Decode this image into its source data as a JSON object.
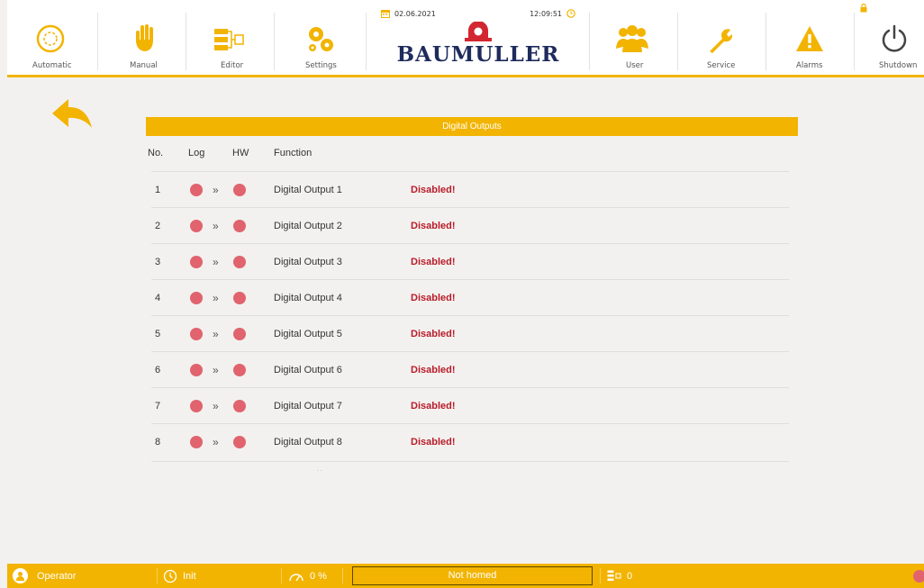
{
  "header": {
    "nav_left": [
      {
        "key": "automatic",
        "label": "Automatic",
        "icon": "automatic-icon"
      },
      {
        "key": "manual",
        "label": "Manual",
        "icon": "hand-icon"
      },
      {
        "key": "editor",
        "label": "Editor",
        "icon": "editor-icon"
      },
      {
        "key": "settings",
        "label": "Settings",
        "icon": "gears-icon"
      }
    ],
    "nav_right": [
      {
        "key": "user",
        "label": "User",
        "icon": "users-icon"
      },
      {
        "key": "service",
        "label": "Service",
        "icon": "wrench-icon"
      },
      {
        "key": "alarms",
        "label": "Alarms",
        "icon": "warning-icon"
      },
      {
        "key": "shutdown",
        "label": "Shutdown",
        "icon": "power-icon"
      }
    ],
    "date": "02.06.2021",
    "time": "12:09:51",
    "brand": "BAUMULLER"
  },
  "table": {
    "title": "Digital Outputs",
    "columns": {
      "no": "No.",
      "log": "Log",
      "hw": "HW",
      "function": "Function"
    },
    "rows": [
      {
        "no": "1",
        "function": "Digital Output 1",
        "status": "Disabled!"
      },
      {
        "no": "2",
        "function": "Digital Output 2",
        "status": "Disabled!"
      },
      {
        "no": "3",
        "function": "Digital Output 3",
        "status": "Disabled!"
      },
      {
        "no": "4",
        "function": "Digital Output 4",
        "status": "Disabled!"
      },
      {
        "no": "5",
        "function": "Digital Output 5",
        "status": "Disabled!"
      },
      {
        "no": "6",
        "function": "Digital Output 6",
        "status": "Disabled!"
      },
      {
        "no": "7",
        "function": "Digital Output 7",
        "status": "Disabled!"
      },
      {
        "no": "8",
        "function": "Digital Output 8",
        "status": "Disabled!"
      }
    ],
    "arrow_glyph": "»"
  },
  "footer": {
    "user": "Operator",
    "mode": "Init",
    "override": "0 %",
    "homing": "Not homed",
    "program": "0"
  },
  "colors": {
    "accent": "#f2b400",
    "led_off": "#e0636e",
    "disabled_text": "#b81c2a",
    "brand": "#1e2b5c",
    "brand_mark": "#d22630"
  }
}
